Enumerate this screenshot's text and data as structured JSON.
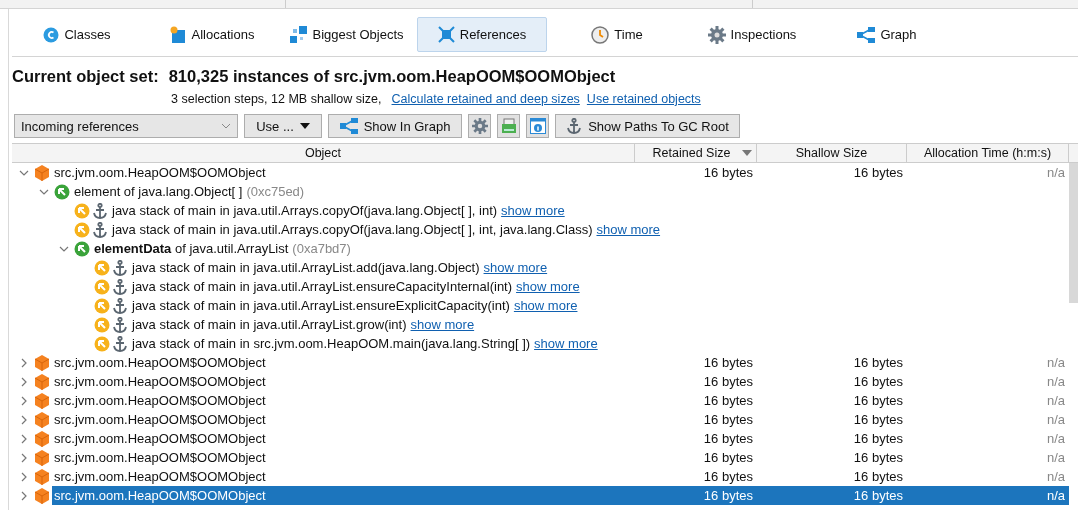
{
  "tabs": [
    {
      "label": "Classes",
      "kind": "classes",
      "selected": false
    },
    {
      "label": "Allocations",
      "kind": "allocations",
      "selected": false
    },
    {
      "label": "Biggest Objects",
      "kind": "biggest",
      "selected": false
    },
    {
      "label": "References",
      "kind": "references",
      "selected": true
    },
    {
      "label": "Time",
      "kind": "time",
      "selected": false
    },
    {
      "label": "Inspections",
      "kind": "inspections",
      "selected": false
    },
    {
      "label": "Graph",
      "kind": "graph",
      "selected": false
    }
  ],
  "object_set": {
    "label": "Current object set:",
    "value": "810,325 instances of src.jvm.oom.HeapOOM$OOMObject"
  },
  "summary": {
    "text": "3 selection steps, 12 MB shallow size,",
    "links": [
      "Calculate retained and deep sizes",
      "Use retained objects"
    ]
  },
  "toolbar": {
    "view_select": "Incoming references",
    "buttons": [
      {
        "kind": "menu",
        "label": "Use ..."
      },
      {
        "kind": "graph",
        "label": "Show In Graph"
      },
      {
        "kind": "settings"
      },
      {
        "kind": "export"
      },
      {
        "kind": "info"
      },
      {
        "kind": "anchor",
        "label": "Show Paths To GC Root"
      }
    ]
  },
  "table": {
    "columns": [
      {
        "label": "Object",
        "sorted": false
      },
      {
        "label": "Retained Size",
        "sorted": true
      },
      {
        "label": "Shallow Size",
        "sorted": false
      },
      {
        "label": "Allocation Time (h:m:s)",
        "sorted": false
      }
    ],
    "rows": [
      {
        "kind": "object",
        "text": "src.jvm.oom.HeapOOM$OOMObject",
        "retained": "16 bytes",
        "shallow": "16 bytes",
        "alloc": "n/a",
        "expanded": true,
        "selected": false,
        "children": [
          {
            "kind": "field",
            "text": "element of java.lang.Object[ ]",
            "address": "(0xc75ed)",
            "expanded": true,
            "selected": false,
            "children": [
              {
                "kind": "stack",
                "text": "java stack of main in java.util.Arrays.copyOf(java.lang.Object[ ], int)",
                "link": "show more",
                "selected": false
              },
              {
                "kind": "stack",
                "text": "java stack of main in java.util.Arrays.copyOf(java.lang.Object[ ], int, java.lang.Class)",
                "link": "show more",
                "selected": false
              },
              {
                "kind": "field",
                "text": "**elementData** of java.util.ArrayList",
                "address": "(0xa7bd7)",
                "expanded": true,
                "selected": false,
                "children": [
                  {
                    "kind": "stack",
                    "text": "java stack of main in java.util.ArrayList.add(java.lang.Object)",
                    "link": "show more",
                    "selected": false
                  },
                  {
                    "kind": "stack",
                    "text": "java stack of main in java.util.ArrayList.ensureCapacityInternal(int)",
                    "link": "show more",
                    "selected": false
                  },
                  {
                    "kind": "stack",
                    "text": "java stack of main in java.util.ArrayList.ensureExplicitCapacity(int)",
                    "link": "show more",
                    "selected": false
                  },
                  {
                    "kind": "stack",
                    "text": "java stack of main in java.util.ArrayList.grow(int)",
                    "link": "show more",
                    "selected": false
                  },
                  {
                    "kind": "stack",
                    "text": "java stack of main in src.jvm.oom.HeapOOM.main(java.lang.String[ ])",
                    "link": "show more",
                    "selected": false
                  }
                ]
              }
            ]
          }
        ]
      },
      {
        "kind": "object",
        "text": "src.jvm.oom.HeapOOM$OOMObject",
        "retained": "16 bytes",
        "shallow": "16 bytes",
        "alloc": "n/a",
        "expanded": false,
        "selected": false
      },
      {
        "kind": "object",
        "text": "src.jvm.oom.HeapOOM$OOMObject",
        "retained": "16 bytes",
        "shallow": "16 bytes",
        "alloc": "n/a",
        "expanded": false,
        "selected": false
      },
      {
        "kind": "object",
        "text": "src.jvm.oom.HeapOOM$OOMObject",
        "retained": "16 bytes",
        "shallow": "16 bytes",
        "alloc": "n/a",
        "expanded": false,
        "selected": false
      },
      {
        "kind": "object",
        "text": "src.jvm.oom.HeapOOM$OOMObject",
        "retained": "16 bytes",
        "shallow": "16 bytes",
        "alloc": "n/a",
        "expanded": false,
        "selected": false
      },
      {
        "kind": "object",
        "text": "src.jvm.oom.HeapOOM$OOMObject",
        "retained": "16 bytes",
        "shallow": "16 bytes",
        "alloc": "n/a",
        "expanded": false,
        "selected": false
      },
      {
        "kind": "object",
        "text": "src.jvm.oom.HeapOOM$OOMObject",
        "retained": "16 bytes",
        "shallow": "16 bytes",
        "alloc": "n/a",
        "expanded": false,
        "selected": false
      },
      {
        "kind": "object",
        "text": "src.jvm.oom.HeapOOM$OOMObject",
        "retained": "16 bytes",
        "shallow": "16 bytes",
        "alloc": "n/a",
        "expanded": false,
        "selected": false
      },
      {
        "kind": "object",
        "text": "src.jvm.oom.HeapOOM$OOMObject",
        "retained": "16 bytes",
        "shallow": "16 bytes",
        "alloc": "n/a",
        "expanded": false,
        "selected": true
      }
    ]
  }
}
